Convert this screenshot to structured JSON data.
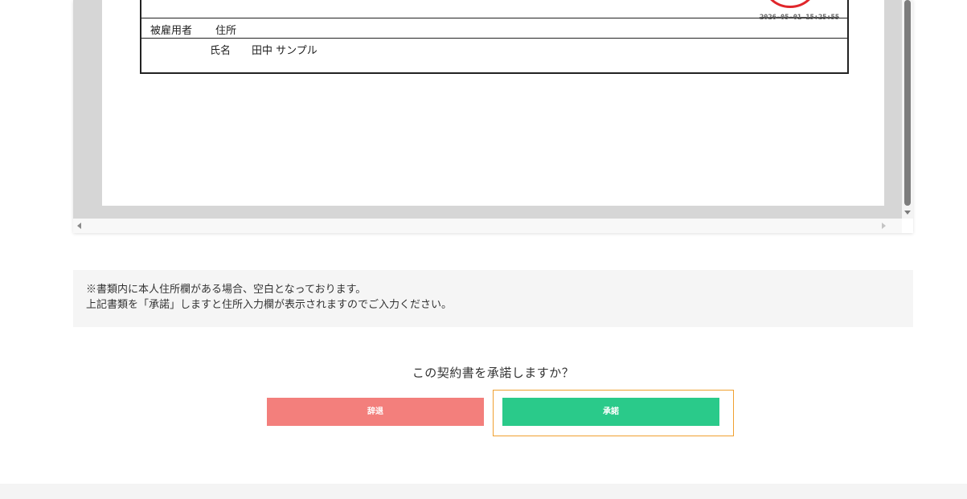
{
  "document": {
    "stamp_timestamp": "2026-05-01 15:25:55",
    "employee_label": "被雇用者",
    "address_label": "住所",
    "name_label": "氏名",
    "name_value": "田中 サンプル"
  },
  "notice": {
    "line1": "※書類内に本人住所欄がある場合、空白となっております。",
    "line2": "上記書類を「承諾」しますと住所入力欄が表示されますのでご入力ください。"
  },
  "prompt": {
    "question": "この契約書を承諾しますか？"
  },
  "buttons": {
    "decline_label": "辞退",
    "accept_label": "承諾"
  },
  "colors": {
    "decline": "#f37f7c",
    "accept": "#2aca8a",
    "seal": "#e0262b",
    "focus": "#f0a030"
  }
}
